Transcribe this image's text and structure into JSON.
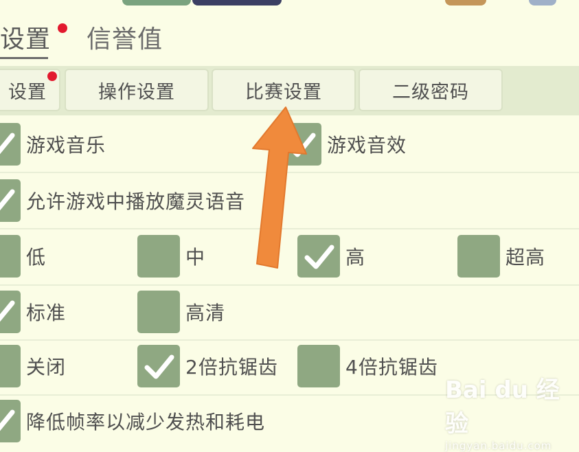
{
  "header": {
    "tabs": [
      {
        "label": "设置",
        "active": true,
        "badge": true
      },
      {
        "label": "信誉值",
        "active": false,
        "badge": false
      }
    ]
  },
  "subtabs": [
    {
      "label": "设置",
      "badge": true
    },
    {
      "label": "操作设置",
      "badge": false
    },
    {
      "label": "比赛设置",
      "badge": false
    },
    {
      "label": "二级密码",
      "badge": false
    }
  ],
  "settings": {
    "row1": [
      {
        "label": "游戏音乐",
        "checked": true
      },
      {
        "label": "游戏音效",
        "checked": true
      }
    ],
    "row2": [
      {
        "label": "允许游戏中播放魔灵语音",
        "checked": true
      }
    ],
    "row3": [
      {
        "label": "低",
        "checked": false
      },
      {
        "label": "中",
        "checked": false
      },
      {
        "label": "高",
        "checked": true
      },
      {
        "label": "超高",
        "checked": false
      }
    ],
    "row4": [
      {
        "label": "标准",
        "checked": true
      },
      {
        "label": "高清",
        "checked": false
      }
    ],
    "row5": [
      {
        "label": "关闭",
        "checked": false
      },
      {
        "label": "2倍抗锯齿",
        "checked": true
      },
      {
        "label": "4倍抗锯齿",
        "checked": false
      }
    ],
    "row6": [
      {
        "label": "降低帧率以减少发热和耗电",
        "checked": true
      }
    ]
  },
  "annotation": {
    "arrow_color": "#f08a3c",
    "target": "比赛设置"
  },
  "watermark": {
    "logo": "Bai du 经验",
    "url": "jingyan.baidu.com"
  },
  "colors": {
    "background": "#fbfde6",
    "checkbox": "#8fa882",
    "badge": "#e2192e",
    "tabbar": "#e3ebcf"
  }
}
